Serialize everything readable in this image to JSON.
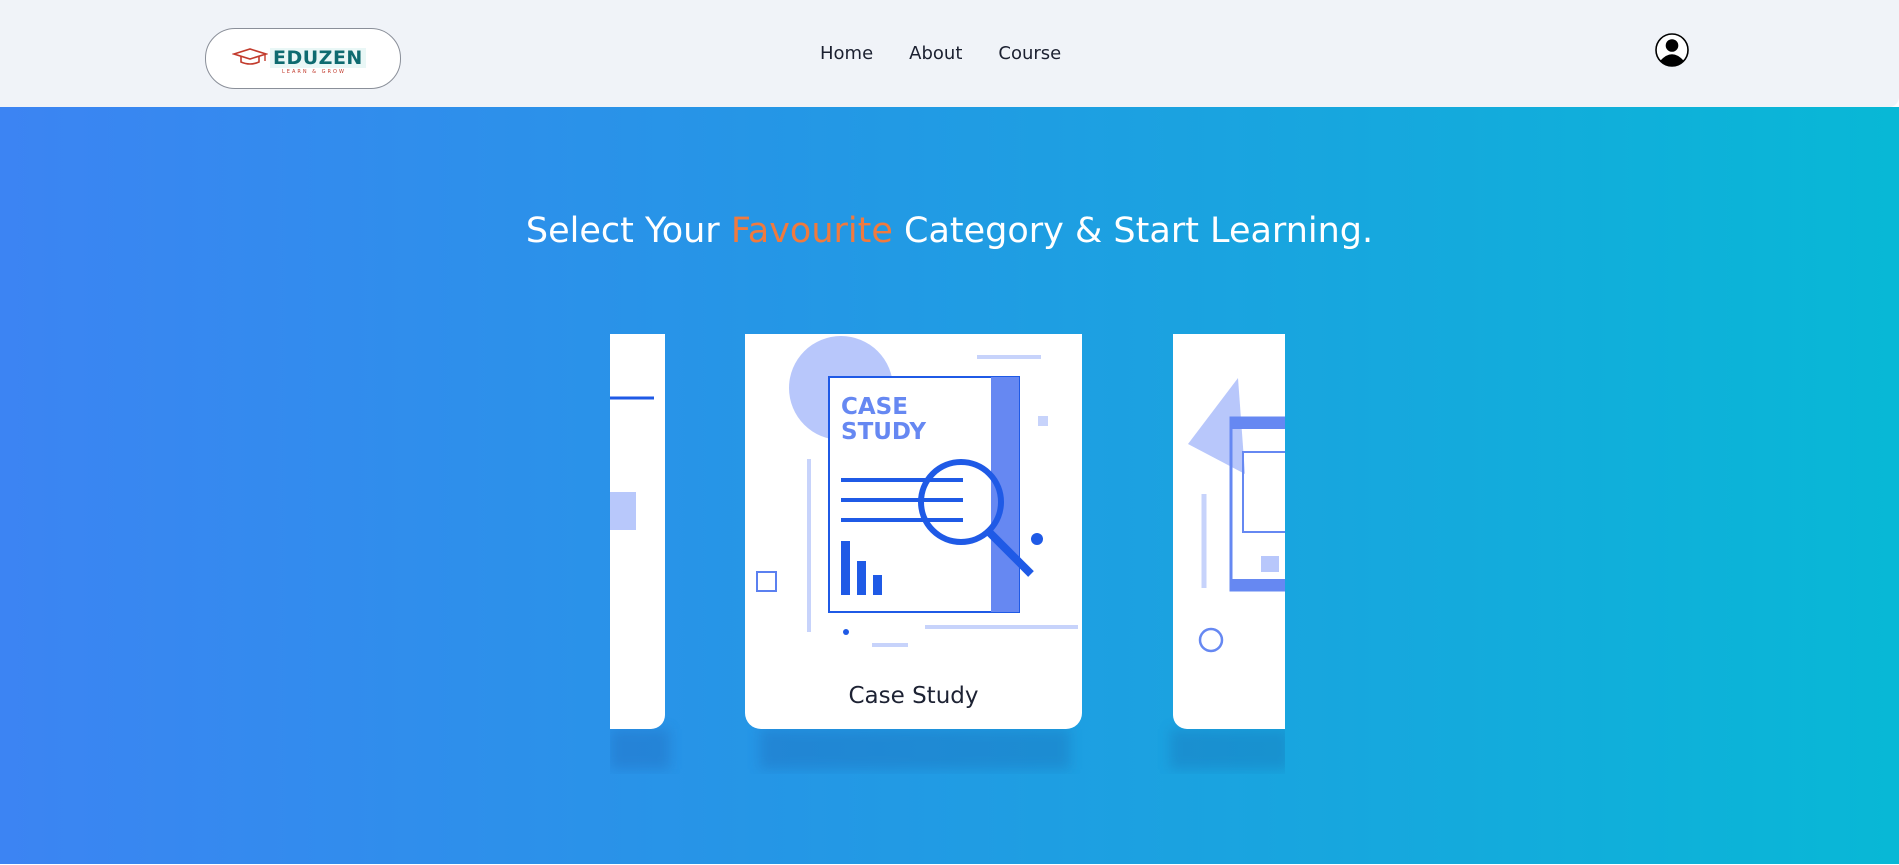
{
  "header": {
    "logo": {
      "name": "EDUZEN",
      "tagline": "LEARN & GROW"
    },
    "nav": [
      "Home",
      "About",
      "Course"
    ],
    "profile_icon": "user-avatar-icon"
  },
  "hero": {
    "headline_pre": "Select Your",
    "headline_accent": "Favourite",
    "headline_post": "Category & Start Learning.",
    "accent_color": "#f07a3e",
    "gradient": [
      "#3c84f3",
      "#08b8d6"
    ]
  },
  "carousel": {
    "cards": [
      {
        "label": ""
      },
      {
        "label": "Case Study",
        "illustration_text": [
          "CASE",
          "STUDY"
        ]
      },
      {
        "label": ""
      }
    ]
  }
}
